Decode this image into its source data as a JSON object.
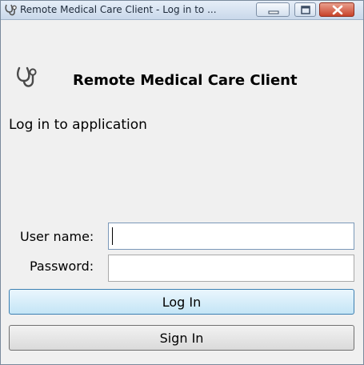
{
  "window": {
    "title": "Remote Medical Care Client - Log in to ...",
    "icon": "stethoscope-icon",
    "controls": {
      "minimize": "minimize-icon",
      "maximize": "maximize-icon",
      "close": "close-icon"
    }
  },
  "header": {
    "logo_icon": "stethoscope-icon",
    "app_name": "Remote Medical Care Client"
  },
  "form": {
    "subtitle": "Log in to application",
    "username_label": "User name:",
    "username_value": "",
    "password_label": "Password:",
    "password_value": "",
    "login_button": "Log In",
    "signin_button": "Sign In"
  },
  "colors": {
    "close_button": "#c8432b",
    "primary_button_border": "#3c7fb1",
    "window_background": "#f0f0f0"
  }
}
